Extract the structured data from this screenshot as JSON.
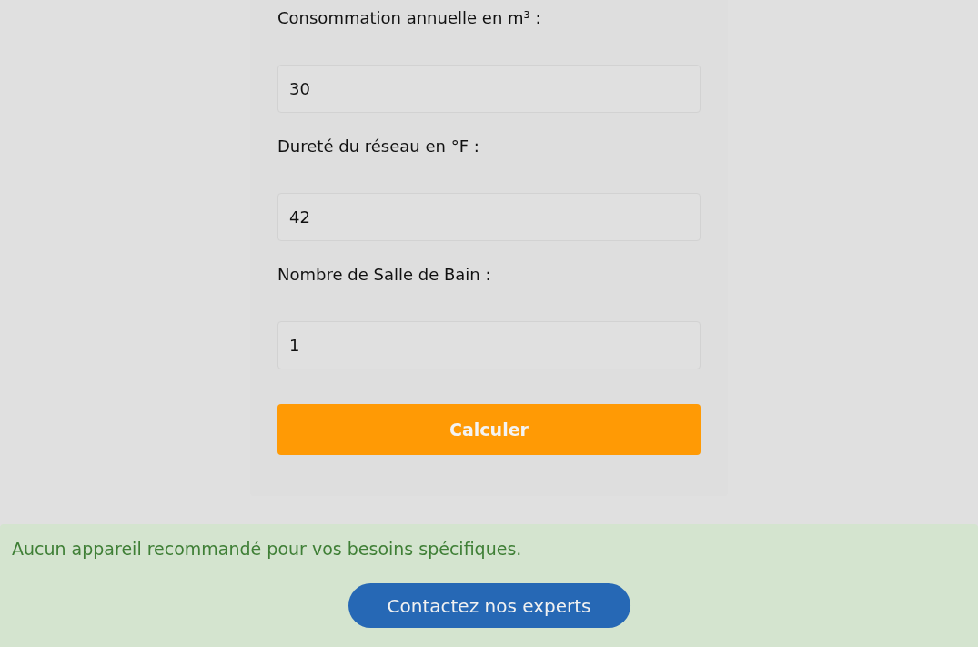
{
  "form": {
    "fields": [
      {
        "label": "Consommation annuelle en m³ :",
        "value": "30"
      },
      {
        "label": "Dureté du réseau en °F :",
        "value": "42"
      },
      {
        "label": "Nombre de Salle de Bain :",
        "value": "1"
      }
    ],
    "submit": "Calculer"
  },
  "result": {
    "message": "Aucun appareil recommandé pour vos besoins spécifiques.",
    "action": "Contactez nos experts"
  }
}
